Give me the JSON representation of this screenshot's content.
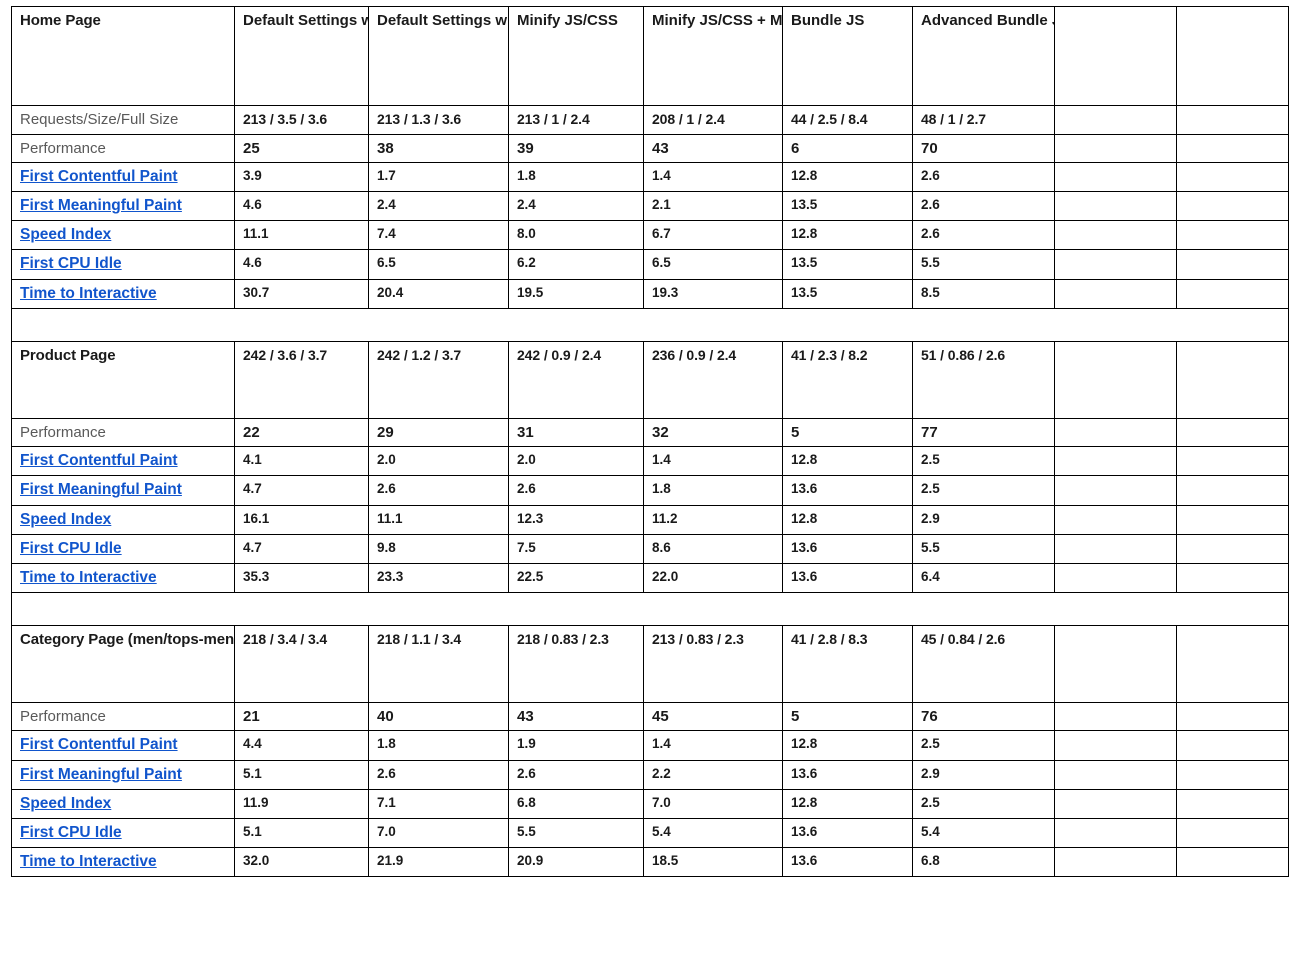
{
  "table": {
    "column_headers": [
      "",
      "Default Settings without  gzip",
      "Default Settings with gzip",
      "Minify JS/CSS",
      "Minify JS/CSS + Merge JS /CSS",
      "Bundle JS",
      "Advanced Bundle JS",
      "",
      ""
    ],
    "colors": {
      "red": "#b3232f",
      "orange": "#e08214",
      "green": "#0f7a3d",
      "black": "#1a1a1a",
      "link": "#1155cc",
      "label": "#595959",
      "border": "#000000"
    },
    "sections": [
      {
        "title": "Home Page",
        "stats_label": "Requests/Size/Full Size",
        "stats": [
          "213 / 3.5 / 3.6",
          "213 / 1.3 / 3.6",
          "213 / 1 / 2.4",
          "208 / 1 / 2.4",
          "44 / 2.5 / 8.4",
          "48 / 1 / 2.7"
        ],
        "performance_label": "Performance",
        "performance": [
          {
            "value": "25",
            "color": "black"
          },
          {
            "value": "38",
            "color": "black"
          },
          {
            "value": "39",
            "color": "black"
          },
          {
            "value": "43",
            "color": "black"
          },
          {
            "value": "6",
            "color": "black"
          },
          {
            "value": "70",
            "color": "black"
          }
        ],
        "metrics": [
          {
            "label": "First Contentful Paint",
            "values": [
              {
                "value": "3.9",
                "color": "orange"
              },
              {
                "value": "1.7",
                "color": "green"
              },
              {
                "value": "1.8",
                "color": "green"
              },
              {
                "value": "1.4",
                "color": "green"
              },
              {
                "value": "12.8",
                "color": "red"
              },
              {
                "value": "2.6",
                "color": "orange"
              }
            ]
          },
          {
            "label": "First Meaningful Paint",
            "values": [
              {
                "value": "4.6",
                "color": "red"
              },
              {
                "value": "2.4",
                "color": "orange"
              },
              {
                "value": "2.4",
                "color": "orange"
              },
              {
                "value": "2.1",
                "color": "green"
              },
              {
                "value": "13.5",
                "color": "red"
              },
              {
                "value": "2.6",
                "color": "orange"
              }
            ]
          },
          {
            "label": "Speed Index",
            "values": [
              {
                "value": "11.1",
                "color": "red"
              },
              {
                "value": "7.4",
                "color": "red"
              },
              {
                "value": "8.0",
                "color": "red"
              },
              {
                "value": "6.7",
                "color": "red"
              },
              {
                "value": "12.8",
                "color": "red"
              },
              {
                "value": "2.6",
                "color": "green"
              }
            ]
          },
          {
            "label": "First CPU Idle",
            "values": [
              {
                "value": "4.6",
                "color": "orange"
              },
              {
                "value": "6.5",
                "color": "orange"
              },
              {
                "value": "6.2",
                "color": "orange"
              },
              {
                "value": "6.5",
                "color": "red"
              },
              {
                "value": "13.5",
                "color": "red"
              },
              {
                "value": "5.5",
                "color": "orange"
              }
            ]
          },
          {
            "label": "Time to Interactive",
            "values": [
              {
                "value": "30.7",
                "color": "red"
              },
              {
                "value": "20.4",
                "color": "red"
              },
              {
                "value": "19.5",
                "color": "red"
              },
              {
                "value": "19.3",
                "color": "red"
              },
              {
                "value": "13.5",
                "color": "red"
              },
              {
                "value": "8.5",
                "color": "red"
              }
            ]
          }
        ]
      },
      {
        "title": "Product Page",
        "stats_label": "",
        "stats": [
          "242 / 3.6 / 3.7",
          "242 / 1.2 / 3.7",
          "242 / 0.9 / 2.4",
          "236 / 0.9 / 2.4",
          "41 / 2.3 / 8.2",
          "51 / 0.86 / 2.6"
        ],
        "performance_label": "Performance",
        "performance": [
          {
            "value": "22",
            "color": "black"
          },
          {
            "value": "29",
            "color": "black"
          },
          {
            "value": "31",
            "color": "black"
          },
          {
            "value": "32",
            "color": "black"
          },
          {
            "value": "5",
            "color": "black"
          },
          {
            "value": "77",
            "color": "black"
          }
        ],
        "metrics": [
          {
            "label": "First Contentful Paint",
            "values": [
              {
                "value": "4.1",
                "color": "red"
              },
              {
                "value": "2.0",
                "color": "green"
              },
              {
                "value": "2.0",
                "color": "green"
              },
              {
                "value": "1.4",
                "color": "green"
              },
              {
                "value": "12.8",
                "color": "red"
              },
              {
                "value": "2.5",
                "color": "orange"
              }
            ]
          },
          {
            "label": "First Meaningful Paint",
            "values": [
              {
                "value": "4.7",
                "color": "red"
              },
              {
                "value": "2.6",
                "color": "orange"
              },
              {
                "value": "2.6",
                "color": "orange"
              },
              {
                "value": "1.8",
                "color": "green"
              },
              {
                "value": "13.6",
                "color": "red"
              },
              {
                "value": "2.5",
                "color": "orange"
              }
            ]
          },
          {
            "label": "Speed Index",
            "values": [
              {
                "value": "16.1",
                "color": "red"
              },
              {
                "value": "11.1",
                "color": "red"
              },
              {
                "value": "12.3",
                "color": "red"
              },
              {
                "value": "11.2",
                "color": "red"
              },
              {
                "value": "12.8",
                "color": "red"
              },
              {
                "value": "2.9",
                "color": "green"
              }
            ]
          },
          {
            "label": "First CPU Idle",
            "values": [
              {
                "value": "4.7",
                "color": "orange"
              },
              {
                "value": "9.8",
                "color": "red"
              },
              {
                "value": "7.5",
                "color": "red"
              },
              {
                "value": "8.6",
                "color": "red"
              },
              {
                "value": "13.6",
                "color": "red"
              },
              {
                "value": "5.5",
                "color": "orange"
              }
            ]
          },
          {
            "label": "Time to Interactive",
            "values": [
              {
                "value": "35.3",
                "color": "red"
              },
              {
                "value": "23.3",
                "color": "red"
              },
              {
                "value": "22.5",
                "color": "red"
              },
              {
                "value": "22.0",
                "color": "red"
              },
              {
                "value": "13.6",
                "color": "red"
              },
              {
                "value": "6.4",
                "color": "orange"
              }
            ]
          }
        ]
      },
      {
        "title": "Category Page (men/tops-men.html)",
        "stats_label": "",
        "stats": [
          "218 / 3.4 / 3.4",
          "218 / 1.1 / 3.4",
          "218 / 0.83 / 2.3",
          "213 / 0.83 / 2.3",
          "41 / 2.8 / 8.3",
          "45 / 0.84 / 2.6"
        ],
        "performance_label": "Performance",
        "performance": [
          {
            "value": "21",
            "color": "black"
          },
          {
            "value": "40",
            "color": "green"
          },
          {
            "value": "43",
            "color": "black"
          },
          {
            "value": "45",
            "color": "black"
          },
          {
            "value": "5",
            "color": "black"
          },
          {
            "value": "76",
            "color": "black"
          }
        ],
        "metrics": [
          {
            "label": "First Contentful Paint",
            "values": [
              {
                "value": "4.4",
                "color": "red"
              },
              {
                "value": "1.8",
                "color": "green"
              },
              {
                "value": "1.9",
                "color": "green"
              },
              {
                "value": "1.4",
                "color": "green"
              },
              {
                "value": "12.8",
                "color": "red"
              },
              {
                "value": "2.5",
                "color": "orange"
              }
            ]
          },
          {
            "label": "First Meaningful Paint",
            "values": [
              {
                "value": "5.1",
                "color": "red"
              },
              {
                "value": "2.6",
                "color": "orange"
              },
              {
                "value": "2.6",
                "color": "orange"
              },
              {
                "value": "2.2",
                "color": "green"
              },
              {
                "value": "13.6",
                "color": "red"
              },
              {
                "value": "2.9",
                "color": "orange"
              }
            ]
          },
          {
            "label": "Speed Index",
            "values": [
              {
                "value": "11.9",
                "color": "red"
              },
              {
                "value": "7.1",
                "color": "red"
              },
              {
                "value": "6.8",
                "color": "red"
              },
              {
                "value": "7.0",
                "color": "red"
              },
              {
                "value": "12.8",
                "color": "red"
              },
              {
                "value": "2.5",
                "color": "green"
              }
            ]
          },
          {
            "label": "First CPU Idle",
            "values": [
              {
                "value": "5.1",
                "color": "orange"
              },
              {
                "value": "7.0",
                "color": "orange"
              },
              {
                "value": "5.5",
                "color": "orange"
              },
              {
                "value": "5.4",
                "color": "orange"
              },
              {
                "value": "13.6",
                "color": "red"
              },
              {
                "value": "5.4",
                "color": "orange"
              }
            ]
          },
          {
            "label": "Time to Interactive",
            "values": [
              {
                "value": "32.0",
                "color": "red"
              },
              {
                "value": "21.9",
                "color": "red"
              },
              {
                "value": "20.9",
                "color": "red"
              },
              {
                "value": "18.5",
                "color": "red"
              },
              {
                "value": "13.6",
                "color": "red"
              },
              {
                "value": "6.8",
                "color": "orange"
              }
            ]
          }
        ]
      }
    ]
  }
}
